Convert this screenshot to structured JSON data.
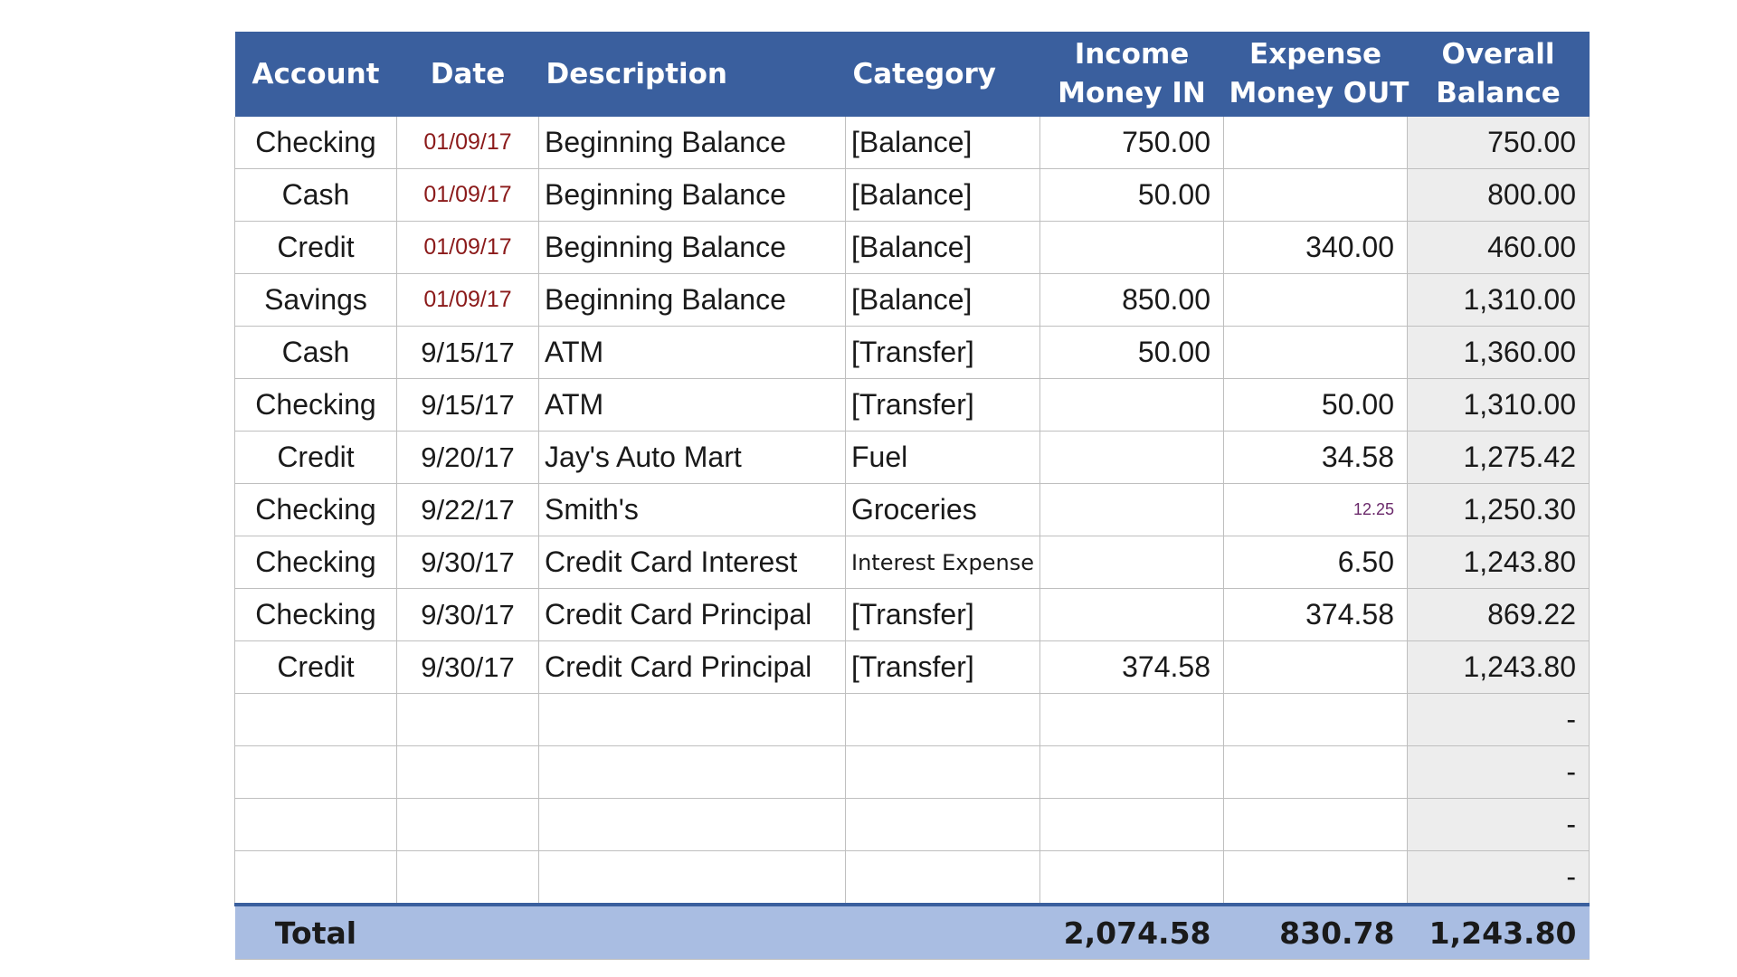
{
  "header": {
    "account": "Account",
    "date": "Date",
    "description": "Description",
    "category": "Category",
    "income_line1": "Income",
    "income_line2": "Money IN",
    "expense_line1": "Expense",
    "expense_line2": "Money OUT",
    "balance_line1": "Overall",
    "balance_line2": "Balance"
  },
  "rows": [
    {
      "account": "Checking",
      "date": "01/09/17",
      "description": "Beginning Balance",
      "category": "[Balance]",
      "income": "750.00",
      "expense": "",
      "balance": "750.00"
    },
    {
      "account": "Cash",
      "date": "01/09/17",
      "description": "Beginning Balance",
      "category": "[Balance]",
      "income": "50.00",
      "expense": "",
      "balance": "800.00"
    },
    {
      "account": "Credit",
      "date": "01/09/17",
      "description": "Beginning Balance",
      "category": "[Balance]",
      "income": "",
      "expense": "340.00",
      "balance": "460.00"
    },
    {
      "account": "Savings",
      "date": "01/09/17",
      "description": "Beginning Balance",
      "category": "[Balance]",
      "income": "850.00",
      "expense": "",
      "balance": "1,310.00"
    },
    {
      "account": "Cash",
      "date": "9/15/17",
      "description": "ATM",
      "category": "[Transfer]",
      "income": "50.00",
      "expense": "",
      "balance": "1,360.00"
    },
    {
      "account": "Checking",
      "date": "9/15/17",
      "description": "ATM",
      "category": "[Transfer]",
      "income": "",
      "expense": "50.00",
      "balance": "1,310.00"
    },
    {
      "account": "Credit",
      "date": "9/20/17",
      "description": "Jay's Auto Mart",
      "category": "Fuel",
      "income": "",
      "expense": "34.58",
      "balance": "1,275.42"
    },
    {
      "account": "Checking",
      "date": "9/22/17",
      "description": "Smith's",
      "category": "Groceries",
      "income": "",
      "expense": "12.25",
      "balance": "1,250.30"
    },
    {
      "account": "Checking",
      "date": "9/30/17",
      "description": "Credit Card Interest",
      "category": "Interest Expense",
      "income": "",
      "expense": "6.50",
      "balance": "1,243.80"
    },
    {
      "account": "Checking",
      "date": "9/30/17",
      "description": "Credit Card Principal",
      "category": "[Transfer]",
      "income": "",
      "expense": "374.58",
      "balance": "869.22"
    },
    {
      "account": "Credit",
      "date": "9/30/17",
      "description": "Credit Card Principal",
      "category": "[Transfer]",
      "income": "374.58",
      "expense": "",
      "balance": "1,243.80"
    },
    {
      "account": "",
      "date": "",
      "description": "",
      "category": "",
      "income": "",
      "expense": "",
      "balance": "-"
    },
    {
      "account": "",
      "date": "",
      "description": "",
      "category": "",
      "income": "",
      "expense": "",
      "balance": "-"
    },
    {
      "account": "",
      "date": "",
      "description": "",
      "category": "",
      "income": "",
      "expense": "",
      "balance": "-"
    },
    {
      "account": "",
      "date": "",
      "description": "",
      "category": "",
      "income": "",
      "expense": "",
      "balance": "-"
    }
  ],
  "totals": {
    "label": "Total",
    "income": "2,074.58",
    "expense": "830.78",
    "balance": "1,243.80"
  },
  "colors": {
    "header_bg": "#3a5f9e",
    "total_bg": "#a9bde2",
    "balance_col_bg": "#ededed",
    "date_red": "#8b1a1a",
    "gridline": "#bfbfbf"
  }
}
